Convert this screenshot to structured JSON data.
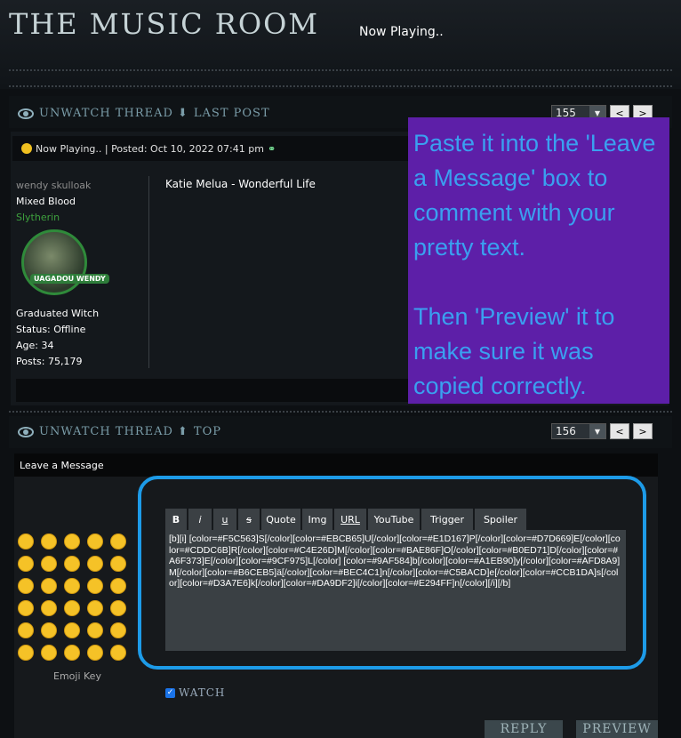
{
  "header": {
    "title": "THE MUSIC ROOM",
    "subtitle": "Now Playing.."
  },
  "bar1": {
    "watch_label": "UNWATCH THREAD",
    "jump_label": "LAST POST",
    "page": "155",
    "prev": "<",
    "next": ">"
  },
  "post": {
    "head": "Now Playing.. | Posted: Oct 10, 2022 07:41 pm",
    "username": "wendy skulloak",
    "blood": "Mixed Blood",
    "house": "Slytherin",
    "avatar_text": "UAGADOU WENDY",
    "rank": "Graduated Witch",
    "status": "Status: Offline",
    "age": "Age: 34",
    "posts": "Posts: 75,179",
    "body": "Katie Melua - Wonderful Life"
  },
  "overlay": {
    "text": "Paste it into the 'Leave a Message' box to comment with your pretty text.\n\nThen 'Preview' it to make sure it was copied correctly."
  },
  "bar2": {
    "watch_label": "UNWATCH THREAD",
    "jump_label": "TOP",
    "page": "156",
    "prev": "<",
    "next": ">"
  },
  "leave_message": {
    "title": "Leave a Message",
    "emoji_key": "Emoji Key",
    "toolbar": [
      "B",
      "i",
      "u",
      "s",
      "Quote",
      "Img",
      "URL",
      "YouTube",
      "Trigger",
      "Spoiler"
    ],
    "text": "[b][i] [color=#F5C563]S[/color][color=#EBCB65]U[/color][color=#E1D167]P[/color][color=#D7D669]E[/color][color=#CDDC6B]R[/color][color=#C4E26D]M[/color][color=#BAE86F]O[/color][color=#B0ED71]D[/color][color=#A6F373]E[/color][color=#9CF975]L[/color] [color=#9AF584]b[/color][color=#A1EB90]y[/color][color=#AFD8A9]M[/color][color=#B6CEB5]ä[/color][color=#BEC4C1]n[/color][color=#C5BACD]e[/color][color=#CCB1DA]s[/color][color=#D3A7E6]k[/color][color=#DA9DF2]i[/color][color=#E294FF]n[/color][/i][/b]",
    "watch": "WATCH",
    "reply": "REPLY",
    "preview": "PREVIEW"
  }
}
